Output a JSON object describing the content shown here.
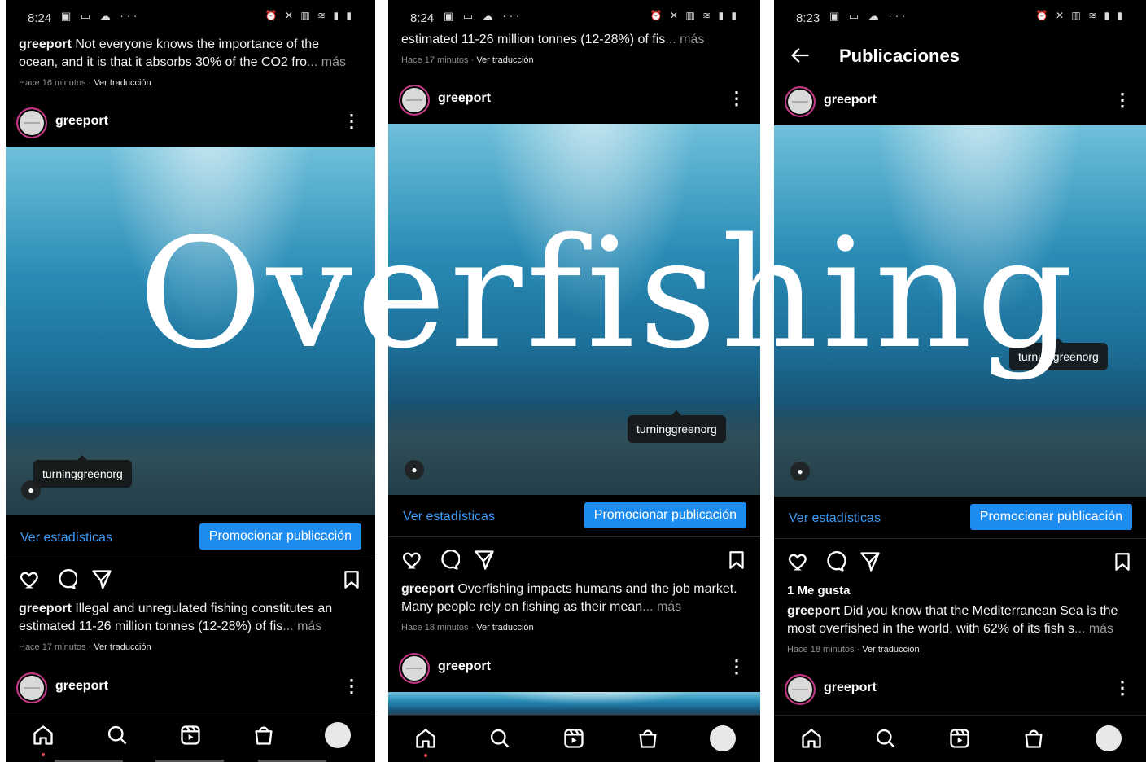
{
  "overlay": {
    "word": "Overfishing"
  },
  "screens": [
    {
      "status_time": "8:24",
      "top_caption": {
        "user": "greeport",
        "text": " Not everyone knows the importance of the ocean, and it is that it absorbs 30% of the CO2 fro",
        "more": "... más"
      },
      "top_meta": {
        "time": "Hace 16 minutos · ",
        "translate": "Ver traducción"
      },
      "post_user": "greeport",
      "tag": "turninggreenorg",
      "stats_link": "Ver estadísticas",
      "promote_button": "Promocionar publicación",
      "caption": {
        "user": "greeport",
        "text": " Illegal and unregulated fishing constitutes an estimated 11-26 million tonnes (12-28%) of fis",
        "more": "... más"
      },
      "meta": {
        "time": "Hace 17 minutos · ",
        "translate": "Ver traducción"
      },
      "next_user": "greeport"
    },
    {
      "status_time": "8:24",
      "top_caption": {
        "text": "estimated 11-26 million tonnes (12-28%) of fis",
        "more": "... más"
      },
      "top_meta": {
        "time": "Hace 17 minutos · ",
        "translate": "Ver traducción"
      },
      "post_user": "greeport",
      "tag": "turninggreenorg",
      "stats_link": "Ver estadísticas",
      "promote_button": "Promocionar publicación",
      "caption": {
        "user": "greeport",
        "text": " Overfishing impacts humans and the job market. Many people rely on fishing as their mean",
        "more": "... más"
      },
      "meta": {
        "time": "Hace 18 minutos · ",
        "translate": "Ver traducción"
      },
      "next_user": "greeport"
    },
    {
      "status_time": "8:23",
      "page_title": "Publicaciones",
      "post_user": "greeport",
      "tag": "turninggreenorg",
      "stats_link": "Ver estadísticas",
      "promote_button": "Promocionar publicación",
      "likes": "1 Me gusta",
      "caption": {
        "user": "greeport",
        "text": " Did you know that the Mediterranean Sea is the most overfished in the world, with 62% of its fish s",
        "more": "... más"
      },
      "meta": {
        "time": "Hace 18 minutos · ",
        "translate": "Ver traducción"
      },
      "next_user": "greeport"
    }
  ],
  "icons": {
    "nav": [
      "home-icon",
      "search-icon",
      "reels-icon",
      "shop-icon",
      "profile-avatar"
    ],
    "actions": [
      "heart-icon",
      "comment-icon",
      "share-icon",
      "bookmark-icon"
    ]
  },
  "colors": {
    "accent_blue": "#1d8cf0",
    "link_blue": "#3d9bf5",
    "notification_red": "#ed4956",
    "background": "#000000"
  }
}
